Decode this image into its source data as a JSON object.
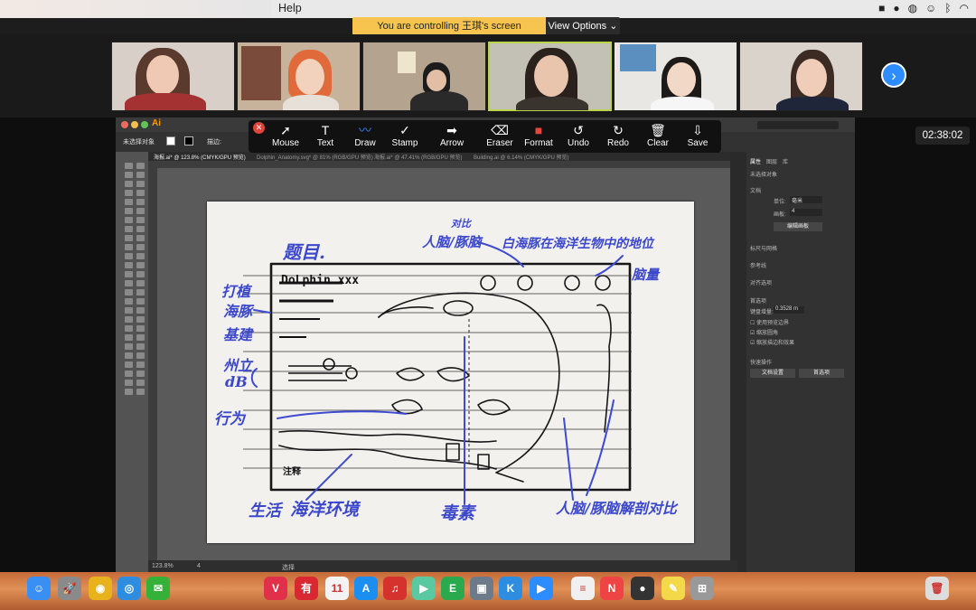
{
  "menubar": {
    "help_label": "Help",
    "tray_icons": [
      "zoom-icon",
      "wechat-icon",
      "chat-icon",
      "qq-icon",
      "bluetooth-icon",
      "wifi-icon"
    ]
  },
  "zoom": {
    "control_text": "You are controlling 王琪's screen",
    "view_options_label": "View Options",
    "timer": "02:38:02",
    "next_page_icon": "chevron-right-icon"
  },
  "annotation_toolbar": {
    "tools": [
      {
        "key": "mouse",
        "label": "Mouse",
        "icon": "cursor-icon"
      },
      {
        "key": "text",
        "label": "Text",
        "icon": "text-icon"
      },
      {
        "key": "draw",
        "label": "Draw",
        "icon": "draw-icon"
      },
      {
        "key": "stamp",
        "label": "Stamp",
        "icon": "check-icon"
      },
      {
        "key": "arrow",
        "label": "Arrow",
        "icon": "arrow-icon"
      },
      {
        "key": "eraser",
        "label": "Eraser",
        "icon": "eraser-icon"
      },
      {
        "key": "format",
        "label": "Format",
        "icon": "color-swatch-icon"
      },
      {
        "key": "undo",
        "label": "Undo",
        "icon": "undo-icon"
      },
      {
        "key": "redo",
        "label": "Redo",
        "icon": "redo-icon"
      },
      {
        "key": "clear",
        "label": "Clear",
        "icon": "trash-icon"
      },
      {
        "key": "save",
        "label": "Save",
        "icon": "save-icon"
      }
    ],
    "colors": {
      "draw": "#2d8cff",
      "format": "#e8453c",
      "close": "#e1443a"
    }
  },
  "illustrator": {
    "zoom_level": "123.8%",
    "page": "4",
    "status_text": "选择",
    "logo": "Ai",
    "no_selection": "未选择对象",
    "stroke_label": "描边:",
    "tabs": [
      "海报.ai* @ 123.8% (CMYK/GPU 预览)",
      "Dolphin_Anatomy.svg* @ 81% (RGB/GPU 预览)",
      "海报.ai* @ 47.41% (RGB/GPU 预览)",
      "Building.ai @ 6.14% (CMYK/GPU 预览)"
    ],
    "panel": {
      "tabs": [
        "属性",
        "图层",
        "库"
      ],
      "section_no_sel": "未选择对象",
      "doc_label": "文档",
      "unit_label": "单位:",
      "unit_value": "毫米",
      "artboard_label": "画板:",
      "artboard_value": "4",
      "edit_artboard_btn": "编辑画板",
      "rulers_grid": "标尺与网格",
      "guides": "参考线",
      "align": "对齐选项",
      "prefs": "首选项",
      "keyboard_incr": "键盘增量:",
      "keyboard_value": "0.3528 m",
      "preview_bounds": "使用预览边界",
      "scale_corners": "缩放圆角",
      "scale_strokes": "缩放描边和效果",
      "quick_actions": "快速操作",
      "doc_setup": "文档设置",
      "preferences_btn": "首选项"
    }
  },
  "sketch": {
    "title_label": "题目.",
    "compare_label": "对比",
    "brain_label": "人脑/豚脑",
    "top_right_note": "白海豚在海洋生物中的地位",
    "top_right_note2": "脑量",
    "left_notes": [
      "打植",
      "海豚",
      "基建",
      "州立",
      "dB",
      "行为"
    ],
    "bottom_notes": [
      "生活",
      "海洋环境",
      "毒素",
      "人脑/豚脑解剖对比"
    ],
    "notes_label": "注释",
    "header_text": "DoLphin.xxx"
  },
  "dock": {
    "apps": [
      {
        "name": "finder-icon",
        "color": "#3a8ff5",
        "glyph": "☺"
      },
      {
        "name": "launchpad-icon",
        "color": "#8a8a8a",
        "glyph": "🚀"
      },
      {
        "name": "chrome-icon",
        "color": "#e7b21c",
        "glyph": "◉"
      },
      {
        "name": "safari-icon",
        "color": "#2f8de0",
        "glyph": "◎"
      },
      {
        "name": "wechat-icon",
        "color": "#35b13a",
        "glyph": "✉"
      },
      {
        "name": "vivaldi-icon",
        "color": "#e0304a",
        "glyph": "V"
      },
      {
        "name": "youdao-icon",
        "color": "#d92832",
        "glyph": "有"
      },
      {
        "name": "calendar-icon",
        "color": "#f3f3f3",
        "glyph": "11"
      },
      {
        "name": "appstore-icon",
        "color": "#1c8ef0",
        "glyph": "A"
      },
      {
        "name": "netease-music-icon",
        "color": "#d6322d",
        "glyph": "♫"
      },
      {
        "name": "infuse-icon",
        "color": "#5ac8a0",
        "glyph": "▶"
      },
      {
        "name": "evernote-icon",
        "color": "#2ba94e",
        "glyph": "E"
      },
      {
        "name": "preview-icon",
        "color": "#6c7a8a",
        "glyph": "▣"
      },
      {
        "name": "keynote-icon",
        "color": "#2f8de0",
        "glyph": "K"
      },
      {
        "name": "zoom-app-icon",
        "color": "#2d8cff",
        "glyph": "▶"
      },
      {
        "name": "textedit-icon",
        "color": "#f0f0f0",
        "glyph": "≡"
      },
      {
        "name": "news-icon",
        "color": "#e44",
        "glyph": "N"
      },
      {
        "name": "recorder-icon",
        "color": "#333",
        "glyph": "●"
      },
      {
        "name": "notes-icon",
        "color": "#f3d94a",
        "glyph": "✎"
      },
      {
        "name": "screenshot-icon",
        "color": "#999",
        "glyph": "⊞"
      },
      {
        "name": "trash-icon",
        "color": "#ddd",
        "glyph": "🗑"
      }
    ],
    "calendar_day": "11"
  }
}
